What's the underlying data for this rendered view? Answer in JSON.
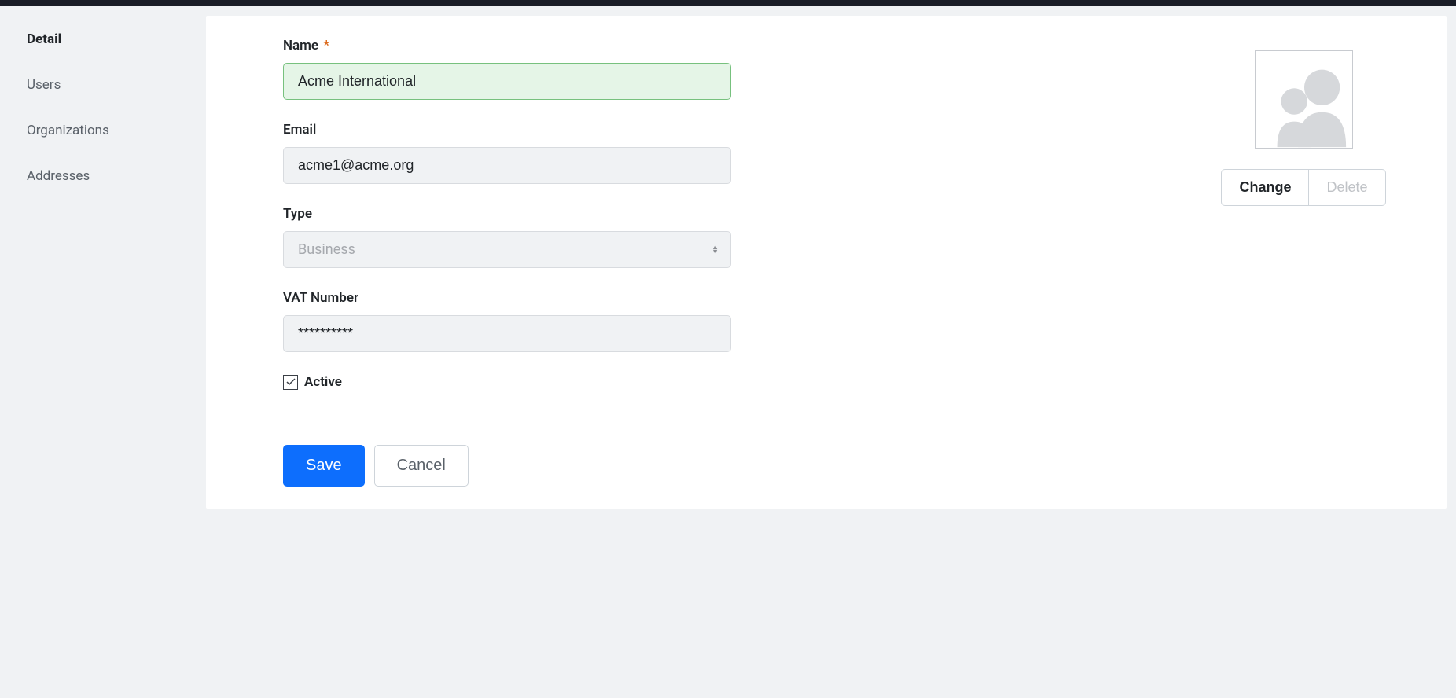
{
  "sidebar": {
    "items": [
      {
        "label": "Detail",
        "active": true
      },
      {
        "label": "Users",
        "active": false
      },
      {
        "label": "Organizations",
        "active": false
      },
      {
        "label": "Addresses",
        "active": false
      }
    ]
  },
  "form": {
    "name_label": "Name",
    "name_value": "Acme International",
    "email_label": "Email",
    "email_value": "acme1@acme.org",
    "type_label": "Type",
    "type_value": "Business",
    "vat_label": "VAT Number",
    "vat_value": "**********",
    "active_label": "Active",
    "active_checked": true
  },
  "buttons": {
    "save": "Save",
    "cancel": "Cancel"
  },
  "avatar": {
    "change": "Change",
    "delete": "Delete"
  }
}
